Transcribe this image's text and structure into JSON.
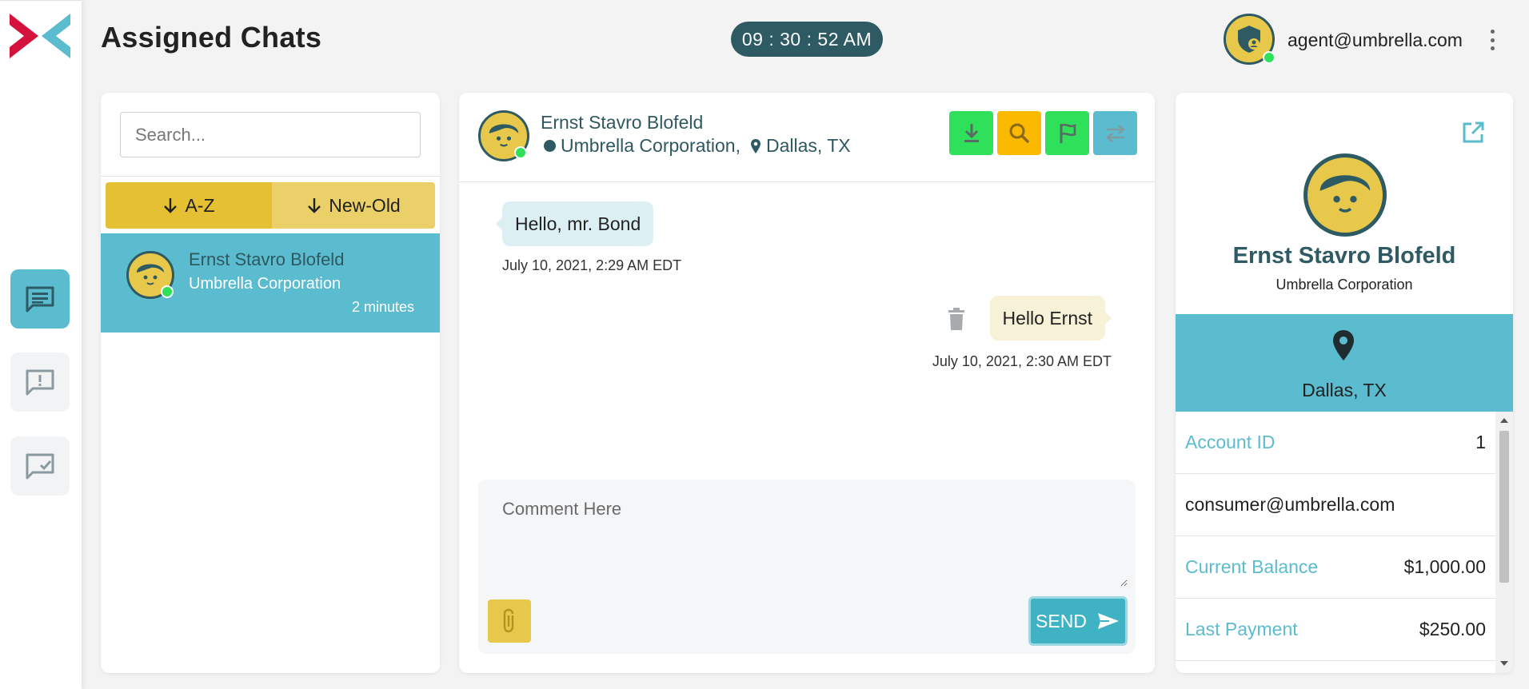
{
  "page": {
    "title": "Assigned Chats"
  },
  "header": {
    "clock": "09 : 30 : 52 AM",
    "agent_email": "agent@umbrella.com"
  },
  "nav": {
    "items": [
      {
        "icon": "chat-icon",
        "active": true
      },
      {
        "icon": "alert-chat-icon",
        "active": false
      },
      {
        "icon": "resolved-chat-icon",
        "active": false
      }
    ]
  },
  "chat_list": {
    "search_placeholder": "Search...",
    "sort_az": "A-Z",
    "sort_new_old": "New-Old",
    "items": [
      {
        "name": "Ernst Stavro Blofeld",
        "company": "Umbrella Corporation",
        "time": "2 minutes"
      }
    ]
  },
  "conversation": {
    "contact_name": "Ernst Stavro Blofeld",
    "company": "Umbrella Corporation,",
    "location": "Dallas, TX",
    "messages": [
      {
        "direction": "in",
        "text": "Hello, mr. Bond",
        "timestamp": "July 10, 2021, 2:29 AM EDT"
      },
      {
        "direction": "out",
        "text": "Hello Ernst",
        "timestamp": "July 10, 2021, 2:30 AM EDT"
      }
    ],
    "comment_placeholder": "Comment Here",
    "send_label": "SEND"
  },
  "profile": {
    "name": "Ernst Stavro Blofeld",
    "company": "Umbrella Corporation",
    "location": "Dallas, TX",
    "rows": [
      {
        "label": "Account ID",
        "value": "1"
      },
      {
        "label": "",
        "value": "consumer@umbrella.com"
      },
      {
        "label": "Current Balance",
        "value": "$1,000.00"
      },
      {
        "label": "Last Payment",
        "value": "$250.00"
      }
    ]
  },
  "colors": {
    "teal_dark": "#2e5a63",
    "teal_light": "#5bbccf",
    "yellow": "#e8c84a",
    "green_action": "#2ee05a",
    "orange_action": "#fbb901"
  }
}
